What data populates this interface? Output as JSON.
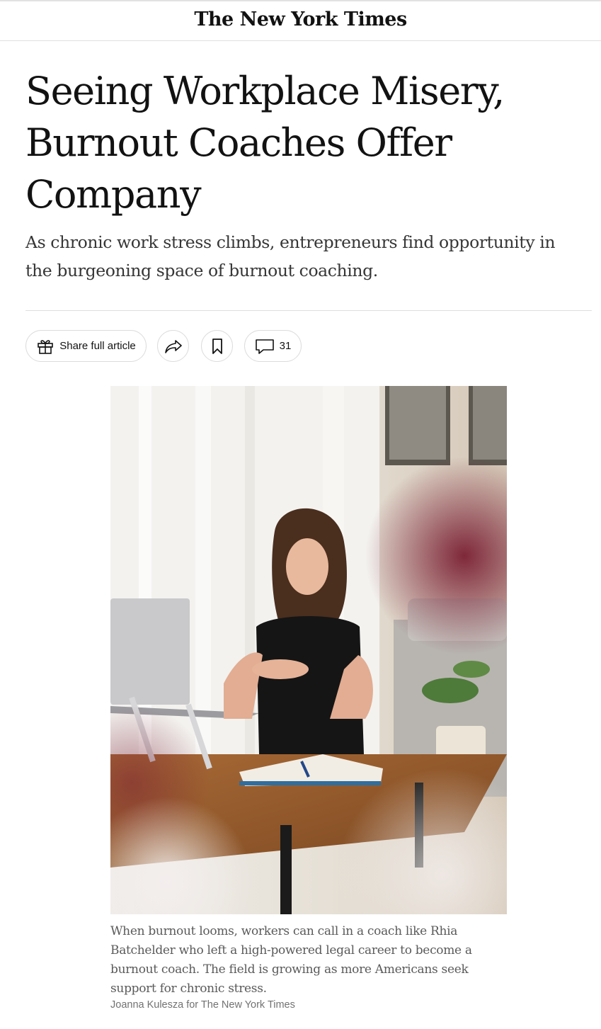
{
  "masthead": {
    "logo_text": "The New York Times"
  },
  "article": {
    "headline": "Seeing Workplace Misery, Burnout Coaches Offer Company",
    "summary": "As chronic work stress climbs, entrepreneurs find opportunity in the burgeoning space of burnout coaching."
  },
  "share_bar": {
    "share_full_label": "Share full article",
    "comment_count": "31",
    "icons": [
      "gift-icon",
      "share-arrow-icon",
      "bookmark-icon",
      "comment-bubble-icon"
    ]
  },
  "lead_image": {
    "caption": "When burnout looms, workers can call in a coach like Rhia Batchelder who left a high-powered legal career to become a burnout coach. The field is growing as more Americans seek support for chronic stress.",
    "credit": "Joanna Kulesza for The New York Times"
  },
  "colors": {
    "text": "#121212",
    "summary_text": "#363636",
    "caption_text": "#5a5a5a",
    "credit_text": "#727272",
    "divider": "#dfdfdf"
  }
}
